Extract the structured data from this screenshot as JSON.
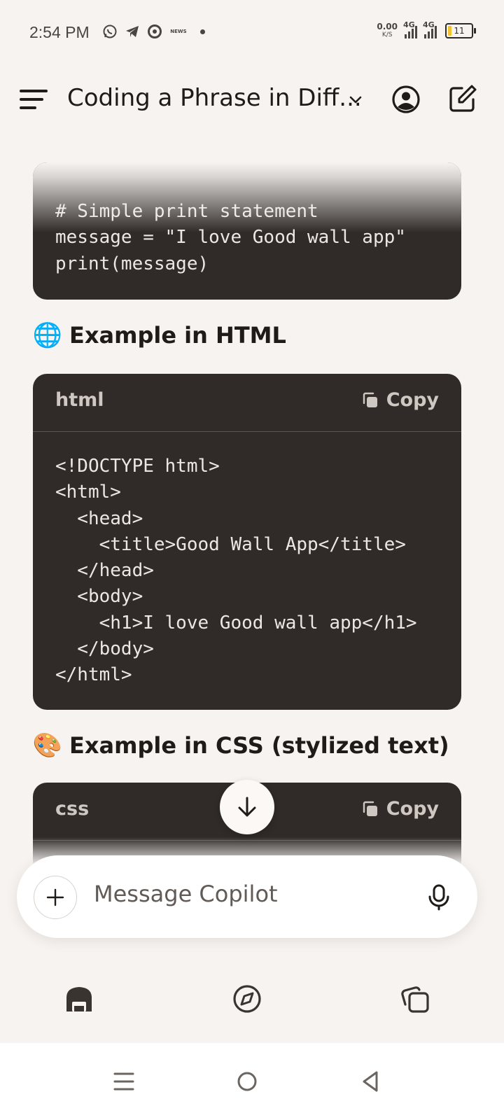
{
  "status_bar": {
    "time": "2:54 PM",
    "notif_icons": [
      "whatsapp-icon",
      "telegram-icon",
      "chrome-icon",
      "news-icon"
    ],
    "news_text": "NEWS",
    "net_speed": "0.00",
    "net_speed_unit": "K/S",
    "signal1_label": "4G",
    "signal2_label": "4G",
    "battery_level": "11",
    "battery_color": "#f2c230"
  },
  "header": {
    "title": "Coding a Phrase in Diff...",
    "icons": [
      "menu-icon",
      "chevron-down-icon",
      "profile-icon",
      "new-chat-icon"
    ]
  },
  "content": {
    "python_block": {
      "code": "# Simple print statement\nmessage = \"I love Good wall app\"\nprint(message)"
    },
    "html_section": {
      "emoji": "🌐",
      "title": "Example in HTML"
    },
    "html_block": {
      "lang": "html",
      "copy_label": "Copy",
      "code": "<!DOCTYPE html>\n<html>\n  <head>\n    <title>Good Wall App</title>\n  </head>\n  <body>\n    <h1>I love Good wall app</h1>\n  </body>\n</html>"
    },
    "css_section": {
      "emoji": "🎨",
      "title": "Example in CSS (stylized text)"
    },
    "css_block": {
      "lang": "css",
      "copy_label": "Copy"
    }
  },
  "composer": {
    "placeholder": "Message Copilot"
  },
  "bottom_nav": {
    "items": [
      "home-icon",
      "discover-icon",
      "pages-icon"
    ]
  },
  "system_nav": {
    "items": [
      "recents-icon",
      "home-circle-icon",
      "back-icon"
    ]
  },
  "colors": {
    "background": "#f7f3f0",
    "code_bg": "#302b28",
    "text": "#1f1b18"
  }
}
